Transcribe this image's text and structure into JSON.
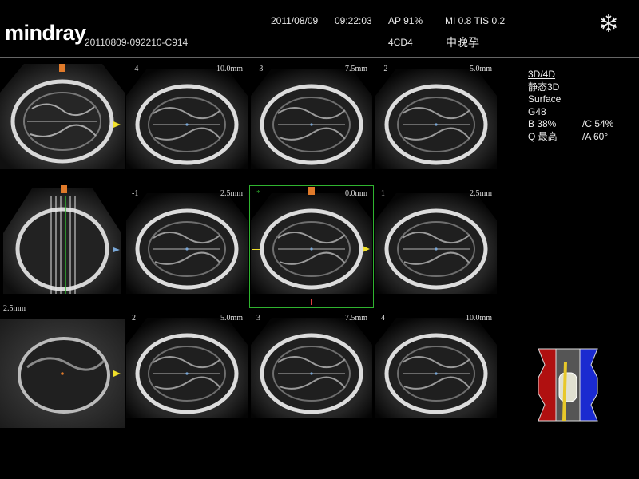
{
  "header": {
    "brand": "mindray",
    "file_id": "20110809-092210-C914",
    "date": "2011/08/09",
    "time": "09:22:03",
    "ap": "AP  91%",
    "mi_tis": "MI 0.8 TIS 0.2",
    "probe": "4CD4",
    "exam": "中晚孕",
    "freeze_icon": "snowflake-icon"
  },
  "side_panel": {
    "mode": "3D/4D",
    "sub_mode": "静态3D",
    "render": "Surface",
    "gain": "G48",
    "brightness": "B 38%",
    "contrast": "/C 54%",
    "quality": "Q 最高",
    "angle": "/A 60°"
  },
  "reference": {
    "thickness": "2.5mm"
  },
  "slices": [
    {
      "index": "-4",
      "distance": "10.0mm",
      "mode": "slice"
    },
    {
      "index": "-3",
      "distance": "7.5mm",
      "mode": "slice"
    },
    {
      "index": "-2",
      "distance": "5.0mm",
      "mode": "slice"
    },
    {
      "index": "-1",
      "distance": "2.5mm",
      "mode": "slice"
    },
    {
      "index": "*",
      "distance": "0.0mm",
      "mode": "selected"
    },
    {
      "index": "1",
      "distance": "2.5mm",
      "mode": "slice"
    },
    {
      "index": "2",
      "distance": "5.0mm",
      "mode": "slice"
    },
    {
      "index": "3",
      "distance": "7.5mm",
      "mode": "slice"
    },
    {
      "index": "4",
      "distance": "10.0mm",
      "mode": "slice"
    }
  ],
  "colors": {
    "accent_green": "#2fb32f",
    "marker_orange": "#e07a2a",
    "marker_yellow": "#f0e02a",
    "marker_blue": "#7aa8d8",
    "cube_red": "#b01010",
    "cube_blue": "#1a2ad0"
  }
}
